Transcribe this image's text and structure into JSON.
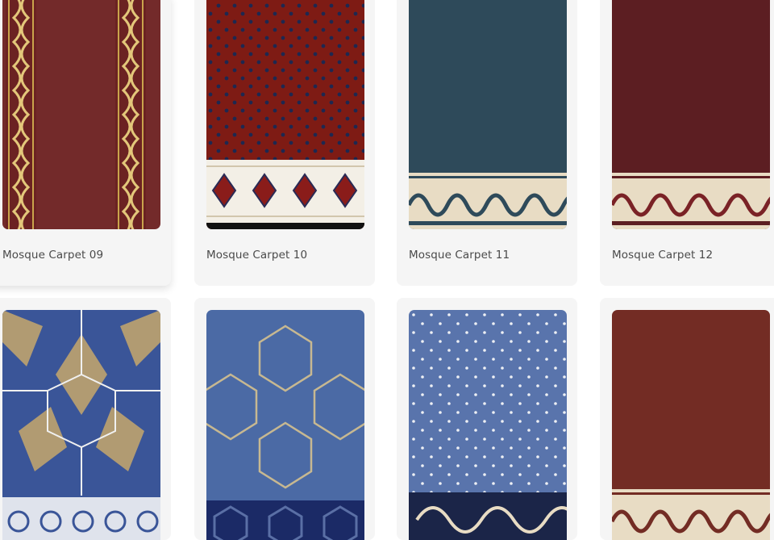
{
  "products": [
    {
      "name": "Mosque Carpet 09",
      "colors": {
        "field": "#732a2a",
        "accent": "#c9a44c"
      }
    },
    {
      "name": "Mosque Carpet 10",
      "colors": {
        "field": "#7e1b14",
        "accent": "#1e2850"
      }
    },
    {
      "name": "Mosque Carpet 11",
      "colors": {
        "field": "#2e4a5a",
        "accent": "#e8dcc4"
      }
    },
    {
      "name": "Mosque Carpet 12",
      "colors": {
        "field": "#5c1e22",
        "accent": "#e8dcc4"
      }
    },
    {
      "name": "",
      "colors": {
        "field": "#3a5598",
        "accent": "#b19b72"
      }
    },
    {
      "name": "",
      "colors": {
        "field": "#4b6aa5",
        "accent": "#c7b891"
      }
    },
    {
      "name": "",
      "colors": {
        "field": "#5974ac",
        "accent": "#eef0f4"
      }
    },
    {
      "name": "",
      "colors": {
        "field": "#732c24",
        "accent": "#e8dcc4"
      }
    }
  ]
}
